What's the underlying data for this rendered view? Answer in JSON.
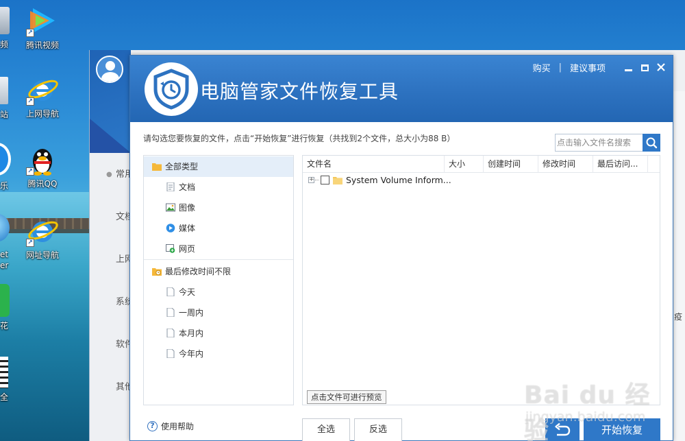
{
  "desktop": {
    "icons": [
      {
        "label": "腾讯视频"
      },
      {
        "label": "上网导航"
      },
      {
        "label": "腾讯QQ"
      },
      {
        "label": "网址导航"
      }
    ],
    "cut_labels": [
      "频",
      "站",
      "乐",
      "et",
      "er",
      "花",
      "全"
    ]
  },
  "bgapp": {
    "nav": [
      "常用",
      "文档",
      "上网",
      "系统",
      "软件",
      "其他"
    ],
    "right_text": [
      "疫"
    ]
  },
  "dialog": {
    "title": "电脑管家文件恢复工具",
    "menu": {
      "buy": "购买",
      "separator": "|",
      "suggest": "建议事项"
    },
    "hint": "请勾选您要恢复的文件，点击“开始恢复”进行恢复（共找到2个文件，总大小为88 B）",
    "search": {
      "placeholder": "点击输入文件名搜索"
    },
    "types": [
      {
        "label": "全部类型",
        "icon": "folder-icon"
      },
      {
        "label": "文档",
        "icon": "document-icon"
      },
      {
        "label": "图像",
        "icon": "image-icon"
      },
      {
        "label": "媒体",
        "icon": "media-icon"
      },
      {
        "label": "网页",
        "icon": "webpage-icon"
      }
    ],
    "times": [
      {
        "label": "最后修改时间不限",
        "icon": "time-folder-icon"
      },
      {
        "label": "今天",
        "icon": "page-icon"
      },
      {
        "label": "一周内",
        "icon": "page-icon"
      },
      {
        "label": "本月内",
        "icon": "page-icon"
      },
      {
        "label": "今年内",
        "icon": "page-icon"
      }
    ],
    "columns": [
      "文件名",
      "大小",
      "创建时间",
      "修改时间",
      "最后访问..."
    ],
    "rows": [
      {
        "expander": "+",
        "name": "System Volume Inform..."
      }
    ],
    "preview_tip": "点击文件可进行预览",
    "help": "使用帮助",
    "buttons": {
      "select_all": "全选",
      "invert": "反选",
      "start": "开始恢复"
    }
  },
  "watermark": {
    "brand": "Bai du 经验",
    "url": "jingyan.baidu.com"
  },
  "colors": {
    "accent": "#2f78c8",
    "title_bar": "#2d72c0",
    "selected_row": "#e4eef9"
  }
}
